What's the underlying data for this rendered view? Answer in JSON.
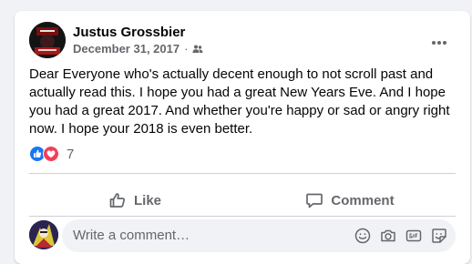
{
  "post": {
    "author": "Justus Grossbier",
    "date": "December 31, 2017",
    "separator": "·",
    "text": "Dear Everyone who's actually decent enough to not scroll past and actually read this. I hope you had a great New Years Eve. And I hope you had a great 2017. And whether you're happy or sad or angry right now. I hope your 2018 is even better.",
    "privacy_icon": "friends-icon",
    "reaction_icons": [
      "like-reaction-icon",
      "love-reaction-icon"
    ],
    "reaction_count": "7"
  },
  "actions": {
    "like_label": "Like",
    "comment_label": "Comment"
  },
  "comment": {
    "placeholder": "Write a comment…",
    "icons": [
      "emoji-icon",
      "camera-icon",
      "gif-icon",
      "sticker-icon"
    ]
  },
  "colors": {
    "like_blue": "#1877f2",
    "love_red": "#f33e58",
    "secondary_text": "#65676b"
  }
}
